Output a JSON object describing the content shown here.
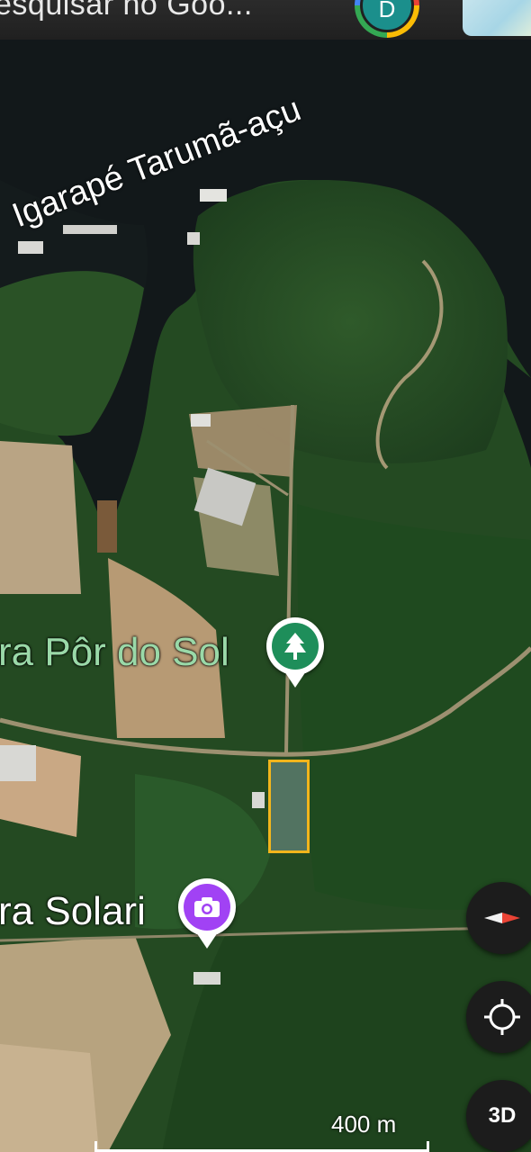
{
  "search": {
    "text": "esquisar no Goo..."
  },
  "account": {
    "initial": "D"
  },
  "map": {
    "river_label": "Igarapé Tarumã-açu",
    "places": [
      {
        "label": "ra Pôr do Sol",
        "icon": "tree-icon",
        "color": "#1e8e5a",
        "label_color": "#9ad9a8"
      },
      {
        "label": "ra Solari",
        "icon": "camera-icon",
        "color": "#a142f4",
        "label_color": "#ffffff"
      }
    ],
    "parcel_color": "#f2b51c"
  },
  "controls": {
    "compass": "compass-icon",
    "locate": "my-location-icon",
    "three_d": "3D"
  },
  "scale": {
    "label": "400 m"
  }
}
